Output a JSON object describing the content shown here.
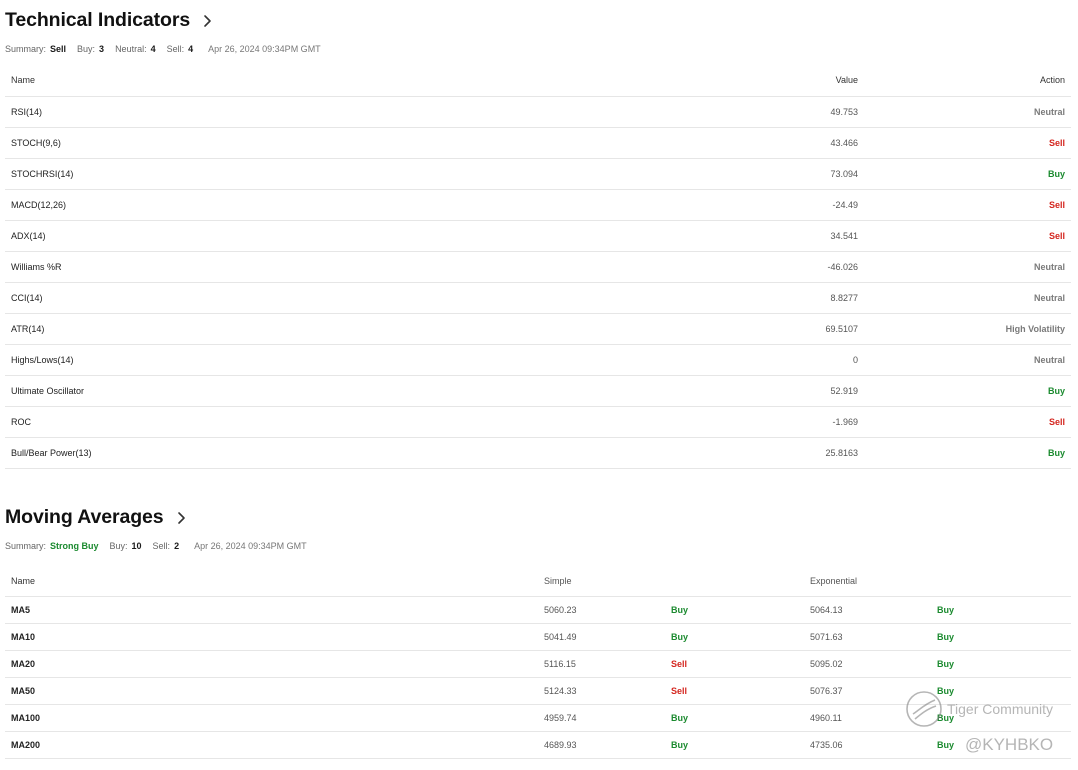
{
  "technical_indicators": {
    "title": "Technical Indicators",
    "summary": {
      "summary_label": "Summary:",
      "summary_value": "Sell",
      "buy_label": "Buy:",
      "buy_value": "3",
      "neutral_label": "Neutral:",
      "neutral_value": "4",
      "sell_label": "Sell:",
      "sell_value": "4",
      "timestamp": "Apr 26, 2024 09:34PM GMT"
    },
    "headers": {
      "name": "Name",
      "value": "Value",
      "action": "Action"
    },
    "rows": [
      {
        "name": "RSI(14)",
        "value": "49.753",
        "action": "Neutral"
      },
      {
        "name": "STOCH(9,6)",
        "value": "43.466",
        "action": "Sell"
      },
      {
        "name": "STOCHRSI(14)",
        "value": "73.094",
        "action": "Buy"
      },
      {
        "name": "MACD(12,26)",
        "value": "-24.49",
        "action": "Sell"
      },
      {
        "name": "ADX(14)",
        "value": "34.541",
        "action": "Sell"
      },
      {
        "name": "Williams %R",
        "value": "-46.026",
        "action": "Neutral"
      },
      {
        "name": "CCI(14)",
        "value": "8.8277",
        "action": "Neutral"
      },
      {
        "name": "ATR(14)",
        "value": "69.5107",
        "action": "High Volatility"
      },
      {
        "name": "Highs/Lows(14)",
        "value": "0",
        "action": "Neutral"
      },
      {
        "name": "Ultimate Oscillator",
        "value": "52.919",
        "action": "Buy"
      },
      {
        "name": "ROC",
        "value": "-1.969",
        "action": "Sell"
      },
      {
        "name": "Bull/Bear Power(13)",
        "value": "25.8163",
        "action": "Buy"
      }
    ]
  },
  "moving_averages": {
    "title": "Moving Averages",
    "summary": {
      "summary_label": "Summary:",
      "summary_value": "Strong Buy",
      "buy_label": "Buy:",
      "buy_value": "10",
      "sell_label": "Sell:",
      "sell_value": "2",
      "timestamp": "Apr 26, 2024 09:34PM GMT"
    },
    "headers": {
      "name": "Name",
      "simple": "Simple",
      "exponential": "Exponential"
    },
    "rows": [
      {
        "name": "MA5",
        "simple": "5060.23",
        "simple_action": "Buy",
        "exponential": "5064.13",
        "exponential_action": "Buy"
      },
      {
        "name": "MA10",
        "simple": "5041.49",
        "simple_action": "Buy",
        "exponential": "5071.63",
        "exponential_action": "Buy"
      },
      {
        "name": "MA20",
        "simple": "5116.15",
        "simple_action": "Sell",
        "exponential": "5095.02",
        "exponential_action": "Buy"
      },
      {
        "name": "MA50",
        "simple": "5124.33",
        "simple_action": "Sell",
        "exponential": "5076.37",
        "exponential_action": "Buy"
      },
      {
        "name": "MA100",
        "simple": "4959.74",
        "simple_action": "Buy",
        "exponential": "4960.11",
        "exponential_action": "Buy"
      },
      {
        "name": "MA200",
        "simple": "4689.93",
        "simple_action": "Buy",
        "exponential": "4735.06",
        "exponential_action": "Buy"
      }
    ]
  },
  "watermark": {
    "brand": "Tiger Community",
    "handle": "@KYHBKO"
  },
  "colors": {
    "buy": "#1b8a2f",
    "sell": "#d4261f",
    "neutral": "#7a7a7a"
  },
  "icons": {
    "title_arrow": "chevron-right-icon",
    "watermark_logo": "tiger-logo-icon"
  }
}
